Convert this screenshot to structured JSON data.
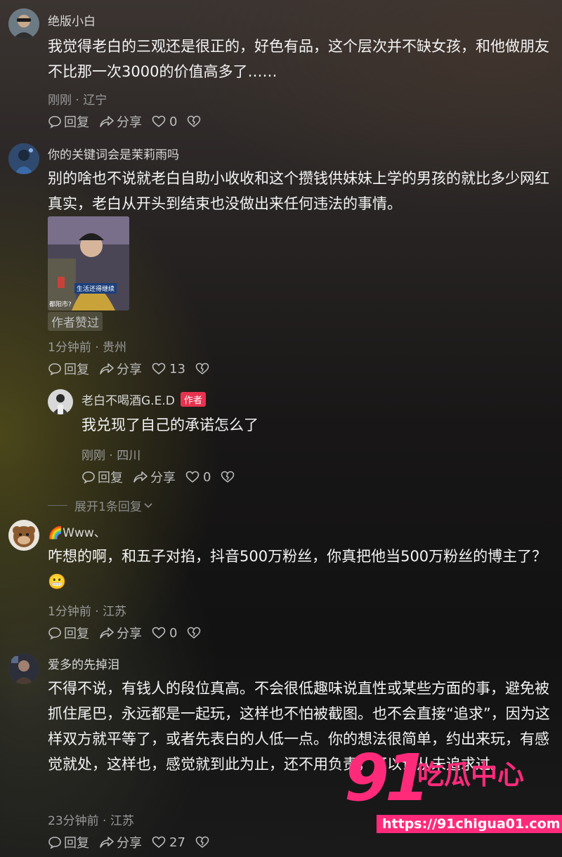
{
  "comments": [
    {
      "username": "绝版小白",
      "text": "我觉得老白的三观还是很正的，好色有品，这个层次并不缺女孩，和他做朋友不比那一次3000的价值高多了……",
      "meta": "刚刚 · 辽宁",
      "reply_label": "回复",
      "share_label": "分享",
      "likes": "0"
    },
    {
      "username": "你的关键词会是茉莉雨吗",
      "text": "别的啥也不说就老白自助小收收和这个攒钱供妹妹上学的男孩的就比多少网红真实，老白从开头到结束也没做出来任何违法的事情。",
      "image_caption": "生活还得继续",
      "image_corner_text": "都阳市?",
      "liked_badge": "作者赞过",
      "meta": "1分钟前 · 贵州",
      "reply_label": "回复",
      "share_label": "分享",
      "likes": "13",
      "reply": {
        "username": "老白不喝酒G.E.D",
        "author_badge": "作者",
        "text": "我兑现了自己的承诺怎么了",
        "meta": "刚刚 · 四川",
        "reply_label": "回复",
        "share_label": "分享",
        "likes": "0"
      },
      "expand_label": "展开1条回复"
    },
    {
      "username": "🌈Www、",
      "text": "咋想的啊，和五子对掐，抖音500万粉丝，你真把他当500万粉丝的博主了？😬",
      "meta": "1分钟前 · 江苏",
      "reply_label": "回复",
      "share_label": "分享",
      "likes": "0"
    },
    {
      "username": "爱多的先掉泪",
      "text": "不得不说，有钱人的段位真高。不会很低趣味说直性或某些方面的事，避免被抓住尾巴，永远都是一起玩，这样也不怕被截图。也不会直接“追求”，因为这样双方就平等了，或者先表白的人低一点。你的想法很简单，约出来玩，有感觉就处，这样也，感觉就到此为止，还不用负责，可以说从未追求过。",
      "meta": "23分钟前 · 江苏",
      "reply_label": "回复",
      "share_label": "分享",
      "likes": "27"
    }
  ],
  "watermark": {
    "number": "91",
    "brand": "吃瓜中心",
    "url": "https://91chigua01.com"
  },
  "colors": {
    "badge_red": "#e8324f",
    "watermark_pink": "#ff2a7a"
  }
}
